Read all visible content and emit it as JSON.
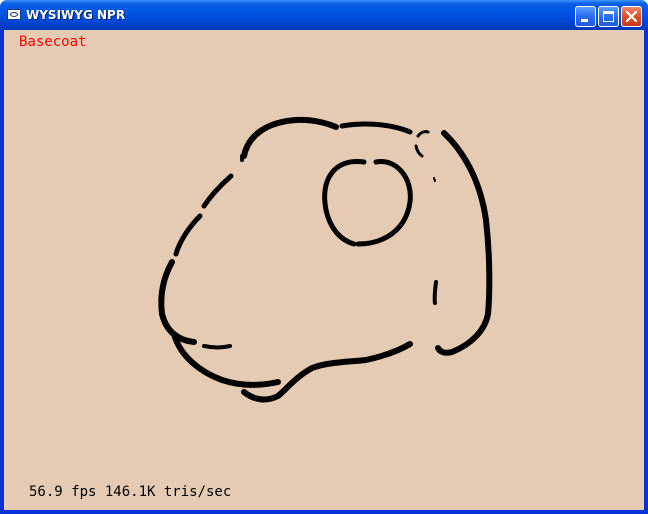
{
  "window": {
    "title": "WYSIWYG NPR"
  },
  "titlebar_buttons": {
    "minimize": "minimize-icon",
    "maximize": "maximize-icon",
    "close": "close-icon"
  },
  "viewport": {
    "mode_label": "Basecoat",
    "stats": "56.9 fps 146.1K tris/sec",
    "background_color": "#e6cbb4",
    "stroke_color": "#000000",
    "mode_label_color": "#ff0000"
  }
}
